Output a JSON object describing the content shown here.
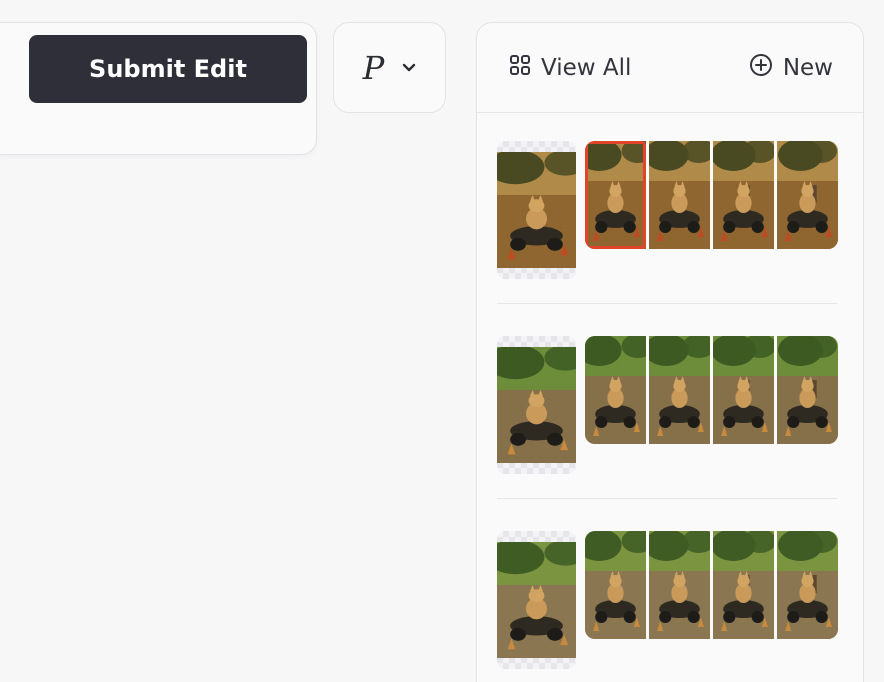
{
  "toolbar": {
    "submit_label": "Submit Edit",
    "mode_letter": "P"
  },
  "panel": {
    "view_all_label": "View All",
    "new_label": "New"
  },
  "groups": [
    {
      "scene": "warm",
      "frame_count": 4,
      "selected_frame": 0,
      "colors": {
        "sky": "#b08a48",
        "ground": "#8f6630",
        "tree": "#4a4a22",
        "accent": "#c24a20"
      }
    },
    {
      "scene": "green",
      "frame_count": 4,
      "selected_frame": null,
      "colors": {
        "sky": "#6d8d3a",
        "ground": "#86704a",
        "tree": "#3c5a22",
        "accent": "#c98a3c"
      }
    },
    {
      "scene": "green",
      "frame_count": 4,
      "selected_frame": null,
      "colors": {
        "sky": "#7a9440",
        "ground": "#8a7650",
        "tree": "#3e5c24",
        "accent": "#c88a40"
      }
    }
  ],
  "icons": {
    "view_all": "grid-icon",
    "new": "plus-circle-icon",
    "dropdown": "chevron-down-icon"
  }
}
